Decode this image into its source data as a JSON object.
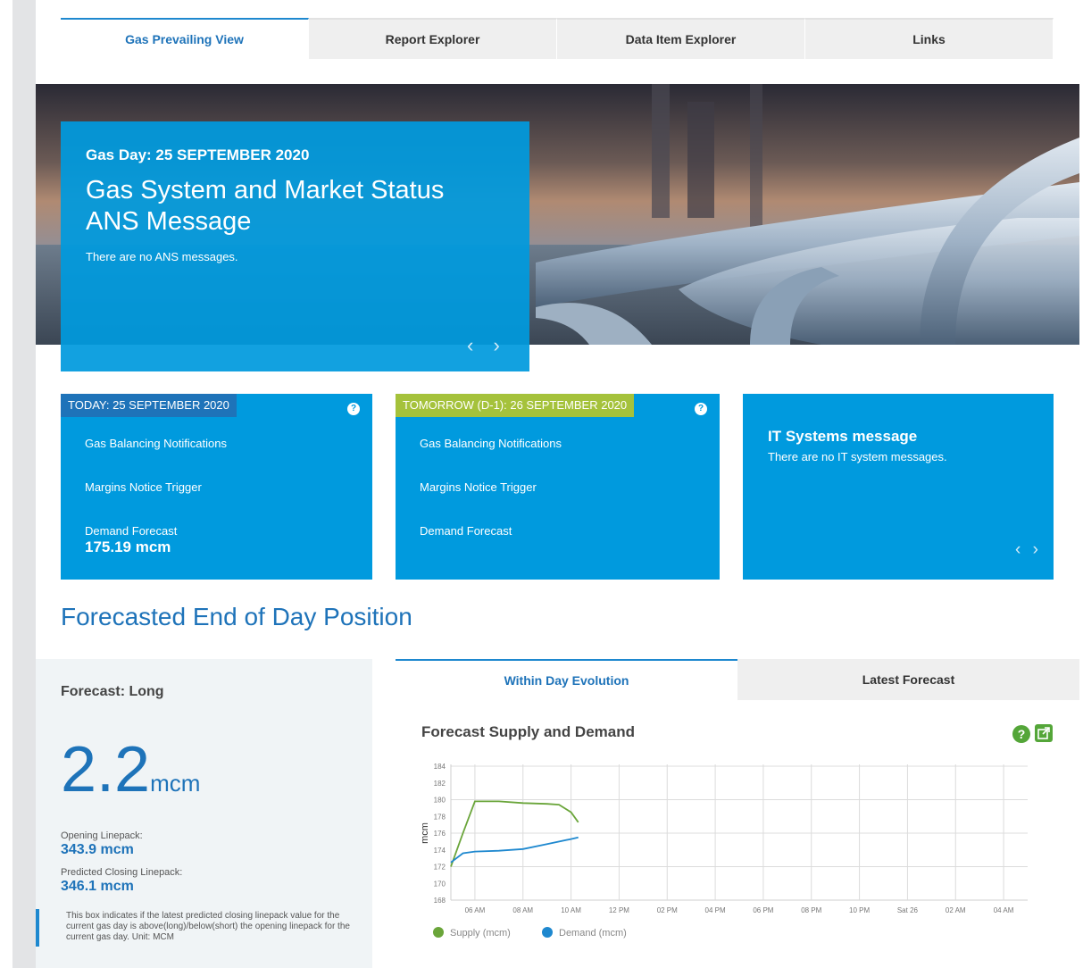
{
  "tabs": [
    "Gas Prevailing View",
    "Report Explorer",
    "Data Item Explorer",
    "Links"
  ],
  "hero": {
    "gas_day": "Gas Day: 25 SEPTEMBER 2020",
    "title": "Gas System and Market Status ANS Message",
    "message": "There are no ANS messages.",
    "arrows": "‹ ›"
  },
  "today": {
    "header": "TODAY: 25 SEPTEMBER 2020",
    "items": [
      "Gas Balancing Notifications",
      "Margins Notice Trigger",
      "Demand Forecast"
    ],
    "demand_value": "175.19  mcm",
    "help": "?"
  },
  "tomorrow": {
    "header": "TOMORROW (D-1): 26 SEPTEMBER 2020",
    "items": [
      "Gas Balancing Notifications",
      "Margins Notice Trigger",
      "Demand Forecast"
    ],
    "help": "?"
  },
  "it_systems": {
    "title": "IT Systems message",
    "message": "There are no IT system messages.",
    "arrows": "‹ ›"
  },
  "section_title": "Forecasted End of Day Position",
  "forecast": {
    "label": "Forecast: Long",
    "value": "2.2",
    "unit": "mcm",
    "opening_label": "Opening Linepack:",
    "opening_value": "343.9 mcm",
    "closing_label": "Predicted Closing Linepack:",
    "closing_value": "346.1 mcm",
    "note": "This box indicates if the latest predicted closing linepack value for the current gas day is above(long)/below(short) the opening linepack for the current gas day. Unit: MCM"
  },
  "chart_tabs": [
    "Within Day Evolution",
    "Latest Forecast"
  ],
  "chart_title": "Forecast Supply and Demand",
  "colors": {
    "accent": "#009ade",
    "tab_active": "#1e73b9",
    "tomorrow_badge": "#a5c23b",
    "supply": "#6aa53a",
    "demand": "#1e88cf"
  },
  "chart_data": {
    "type": "line",
    "ylabel": "mcm",
    "ylim": [
      168,
      184
    ],
    "yticks": [
      168,
      170,
      172,
      174,
      176,
      178,
      180,
      182,
      184
    ],
    "x_ticks": [
      "06 AM",
      "08 AM",
      "10 AM",
      "12 PM",
      "02 PM",
      "04 PM",
      "06 PM",
      "08 PM",
      "10 PM",
      "Sat 26",
      "02 AM",
      "04 AM"
    ],
    "x_hours_range": [
      5,
      29
    ],
    "series": [
      {
        "name": "Supply (mcm)",
        "color": "#6aa53a",
        "points": [
          [
            5.0,
            172.0
          ],
          [
            5.5,
            176.0
          ],
          [
            6.0,
            179.8
          ],
          [
            7.0,
            179.8
          ],
          [
            8.0,
            179.6
          ],
          [
            9.0,
            179.5
          ],
          [
            9.5,
            179.4
          ],
          [
            10.0,
            178.5
          ],
          [
            10.3,
            177.3
          ]
        ]
      },
      {
        "name": "Demand (mcm)",
        "color": "#1e88cf",
        "points": [
          [
            5.0,
            172.5
          ],
          [
            5.5,
            173.6
          ],
          [
            6.0,
            173.8
          ],
          [
            7.0,
            173.9
          ],
          [
            8.0,
            174.1
          ],
          [
            9.0,
            174.7
          ],
          [
            10.0,
            175.3
          ],
          [
            10.3,
            175.5
          ]
        ]
      }
    ]
  }
}
